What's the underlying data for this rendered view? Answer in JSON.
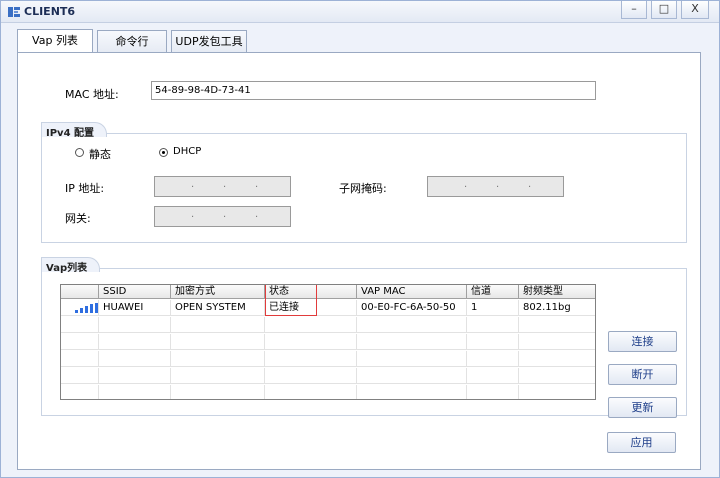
{
  "window": {
    "title": "CLIENT6",
    "minimize_glyph": "–",
    "maximize_glyph": "□",
    "close_glyph": "X"
  },
  "tabs": [
    {
      "label": "Vap 列表",
      "active": true
    },
    {
      "label": "命令行",
      "active": false
    },
    {
      "label": "UDP发包工具",
      "active": false
    }
  ],
  "mac": {
    "label": "MAC 地址:",
    "value": "54-89-98-4D-73-41"
  },
  "ipv4": {
    "title": "IPv4 配置",
    "static_label": "静态",
    "dhcp_label": "DHCP",
    "selected": "DHCP",
    "ip_label": "IP 地址:",
    "mask_label": "子网掩码:",
    "gateway_label": "网关:"
  },
  "vap": {
    "title": "Vap列表",
    "columns": [
      "",
      "SSID",
      "加密方式",
      "状态",
      "VAP MAC",
      "信道",
      "射频类型"
    ],
    "rows": [
      {
        "signal": "signal-strength-icon",
        "ssid": "HUAWEI",
        "encryption": "OPEN SYSTEM",
        "status": "已连接",
        "vap_mac": "00-E0-FC-6A-50-50",
        "channel": "1",
        "radio_type": "802.11bg"
      }
    ],
    "buttons": {
      "connect": "连接",
      "disconnect": "断开",
      "refresh": "更新"
    }
  },
  "apply_label": "应用",
  "colors": {
    "accent": "#2f6ee0",
    "highlight": "#e13b3b",
    "button_text": "#1f3f8a"
  }
}
